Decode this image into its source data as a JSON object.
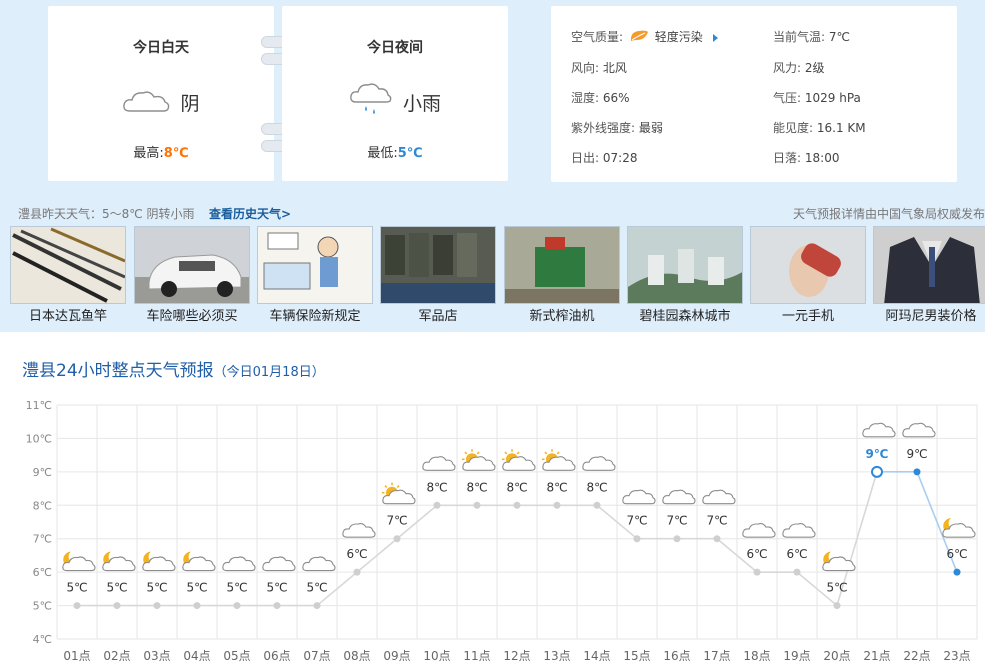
{
  "day": {
    "title": "今日白天",
    "cond": "阴",
    "temp_label": "最高:",
    "temp": "8℃",
    "icon": "cloud-icon"
  },
  "night": {
    "title": "今日夜间",
    "cond": "小雨",
    "temp_label": "最低:",
    "temp": "5℃",
    "icon": "light-rain-icon"
  },
  "details": {
    "aq_label": "空气质量:",
    "aq_value": "轻度污染",
    "cur_temp_label": "当前气温:",
    "cur_temp": "7℃",
    "wind_dir_label": "风向:",
    "wind_dir": "北风",
    "wind_force_label": "风力:",
    "wind_force": "2级",
    "humidity_label": "湿度:",
    "humidity": "66%",
    "pressure_label": "气压:",
    "pressure": "1029 hPa",
    "uv_label": "紫外线强度:",
    "uv": "最弱",
    "visibility_label": "能见度:",
    "visibility": "16.1 KM",
    "sunrise_label": "日出:",
    "sunrise": "07:28",
    "sunset_label": "日落:",
    "sunset": "18:00"
  },
  "yesterday": "澧县昨天天气：5～8℃ 阴转小雨",
  "history_link": "查看历史天气>",
  "source_note": "天气预报详情由中国气象局权威发布",
  "ads": [
    {
      "caption": "日本达瓦鱼竿",
      "color1": "#e8e2d4",
      "color2": "#3a3a3a"
    },
    {
      "caption": "车险哪些必须买",
      "color1": "#c8ccd0",
      "color2": "#f2f2f2"
    },
    {
      "caption": "车辆保险新规定",
      "color1": "#f4f2ec",
      "color2": "#7fa7cf"
    },
    {
      "caption": "军品店",
      "color1": "#5d6157",
      "color2": "#3b3d35"
    },
    {
      "caption": "新式榨油机",
      "color1": "#9fa08d",
      "color2": "#2b6e3c"
    },
    {
      "caption": "碧桂园森林城市",
      "color1": "#b9c8c6",
      "color2": "#58755a"
    },
    {
      "caption": "一元手机",
      "color1": "#d9dcdf",
      "color2": "#c44a3c"
    },
    {
      "caption": "阿玛尼男装价格",
      "color1": "#c8c8c8",
      "color2": "#2c2f3a"
    }
  ],
  "forecast": {
    "title": "澧县24小时整点天气预报",
    "date": "（今日01月18日）"
  },
  "chart_data": {
    "type": "line",
    "x": [
      "01点",
      "02点",
      "03点",
      "04点",
      "05点",
      "06点",
      "07点",
      "08点",
      "09点",
      "10点",
      "11点",
      "12点",
      "13点",
      "14点",
      "15点",
      "16点",
      "17点",
      "18点",
      "19点",
      "20点",
      "21点",
      "22点",
      "23点"
    ],
    "values": [
      5,
      5,
      5,
      5,
      5,
      5,
      5,
      6,
      7,
      8,
      8,
      8,
      8,
      8,
      7,
      7,
      7,
      6,
      6,
      5,
      9,
      9,
      6
    ],
    "point_labels": [
      "5℃",
      "5℃",
      "5℃",
      "5℃",
      "5℃",
      "5℃",
      "5℃",
      "6℃",
      "7℃",
      "8℃",
      "8℃",
      "8℃",
      "8℃",
      "8℃",
      "7℃",
      "7℃",
      "7℃",
      "6℃",
      "6℃",
      "5℃",
      "9℃",
      "9℃",
      "6℃"
    ],
    "icons": [
      "moon-cloud",
      "moon-cloud",
      "moon-cloud",
      "moon-cloud",
      "cloud",
      "cloud",
      "cloud",
      "cloud",
      "sun-cloud",
      "cloud",
      "sun-cloud",
      "sun-cloud",
      "sun-cloud",
      "cloud",
      "cloud",
      "cloud",
      "cloud",
      "cloud",
      "cloud",
      "moon-cloud",
      "cloud",
      "cloud",
      "moon-cloud"
    ],
    "yticks": [
      "4℃",
      "5℃",
      "6℃",
      "7℃",
      "8℃",
      "9℃",
      "10℃",
      "11℃"
    ],
    "ylim": [
      4,
      11
    ],
    "grid": true,
    "past_color": "#d8d8d8",
    "future_color": "#2d88d8",
    "current_index": 20
  }
}
